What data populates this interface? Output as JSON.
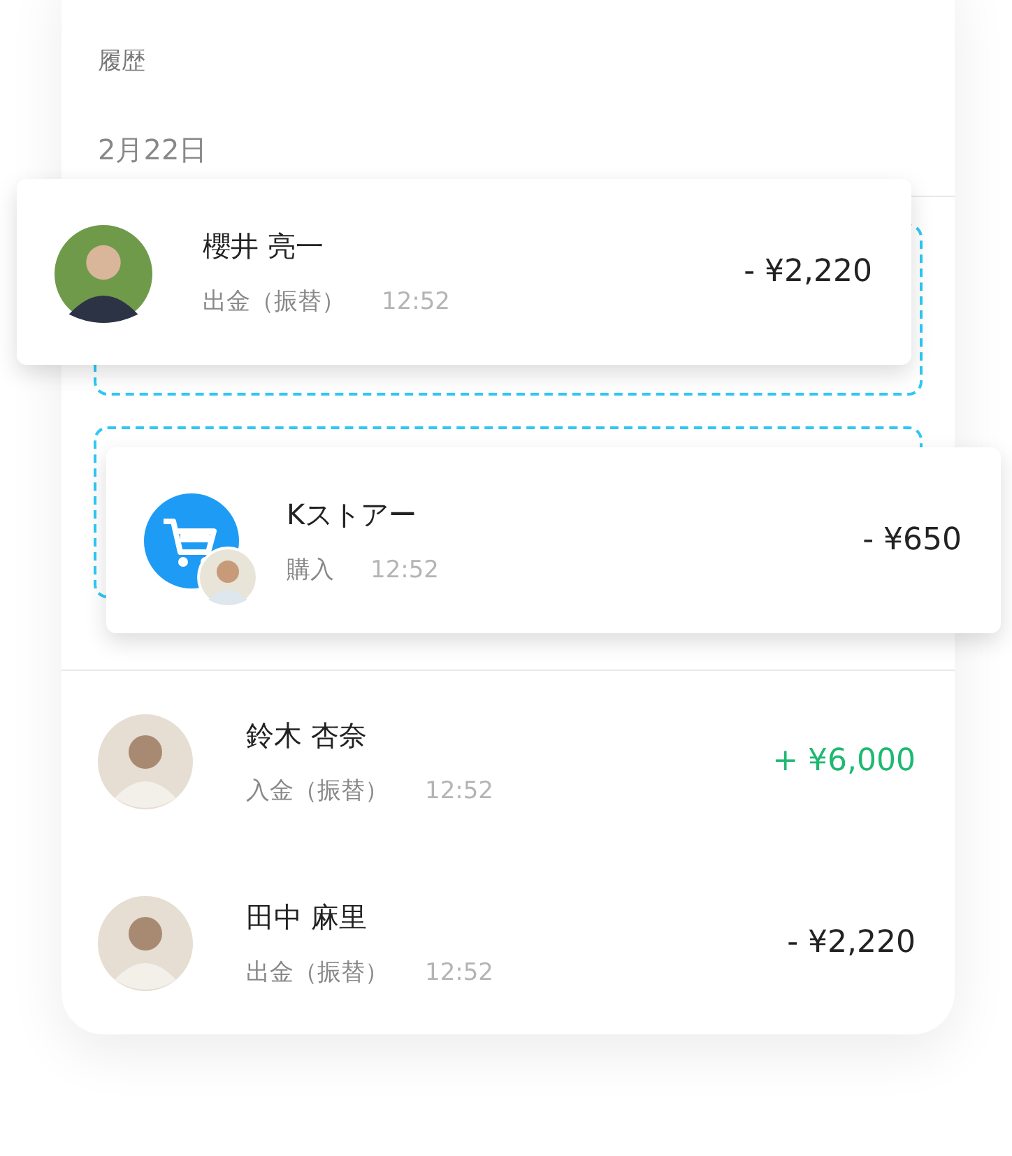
{
  "header": {
    "title": "履歴"
  },
  "date": "2月22日",
  "dragged_items": [
    {
      "name": "櫻井 亮一",
      "type": "出金（振替）",
      "time": "12:52",
      "amount": "- ¥2,220",
      "color": "#222222",
      "kind": "person"
    },
    {
      "name": "Kストアー",
      "type": "購入",
      "time": "12:52",
      "amount": "- ¥650",
      "color": "#222222",
      "kind": "store"
    }
  ],
  "list_items": [
    {
      "name": "鈴木 杏奈",
      "type": "入金（振替）",
      "time": "12:52",
      "amount": "+ ¥6,000",
      "color": "#1db971",
      "kind": "person"
    },
    {
      "name": "田中 麻里",
      "type": "出金（振替）",
      "time": "12:52",
      "amount": "- ¥2,220",
      "color": "#222222",
      "kind": "person"
    }
  ]
}
